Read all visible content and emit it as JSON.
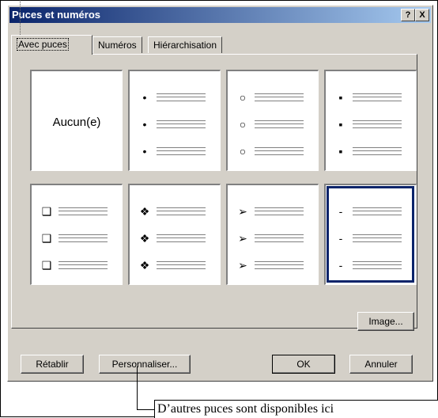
{
  "window": {
    "title": "Puces et numéros",
    "help_btn": "?",
    "close_btn": "X"
  },
  "tabs": [
    {
      "label": "Avec puces",
      "active": true
    },
    {
      "label": "Numéros",
      "active": false
    },
    {
      "label": "Hiérarchisation",
      "active": false
    }
  ],
  "gallery": {
    "none_label": "Aucun(e)",
    "bullets": [
      "•",
      "○",
      "▪",
      "❑",
      "❖",
      "➢",
      "-"
    ],
    "selected_index": 7
  },
  "buttons": {
    "image": "Image...",
    "reset": "Rétablir",
    "customize": "Personnaliser...",
    "ok": "OK",
    "cancel": "Annuler"
  },
  "callout": {
    "text": "D’autres puces sont disponibles ici"
  }
}
